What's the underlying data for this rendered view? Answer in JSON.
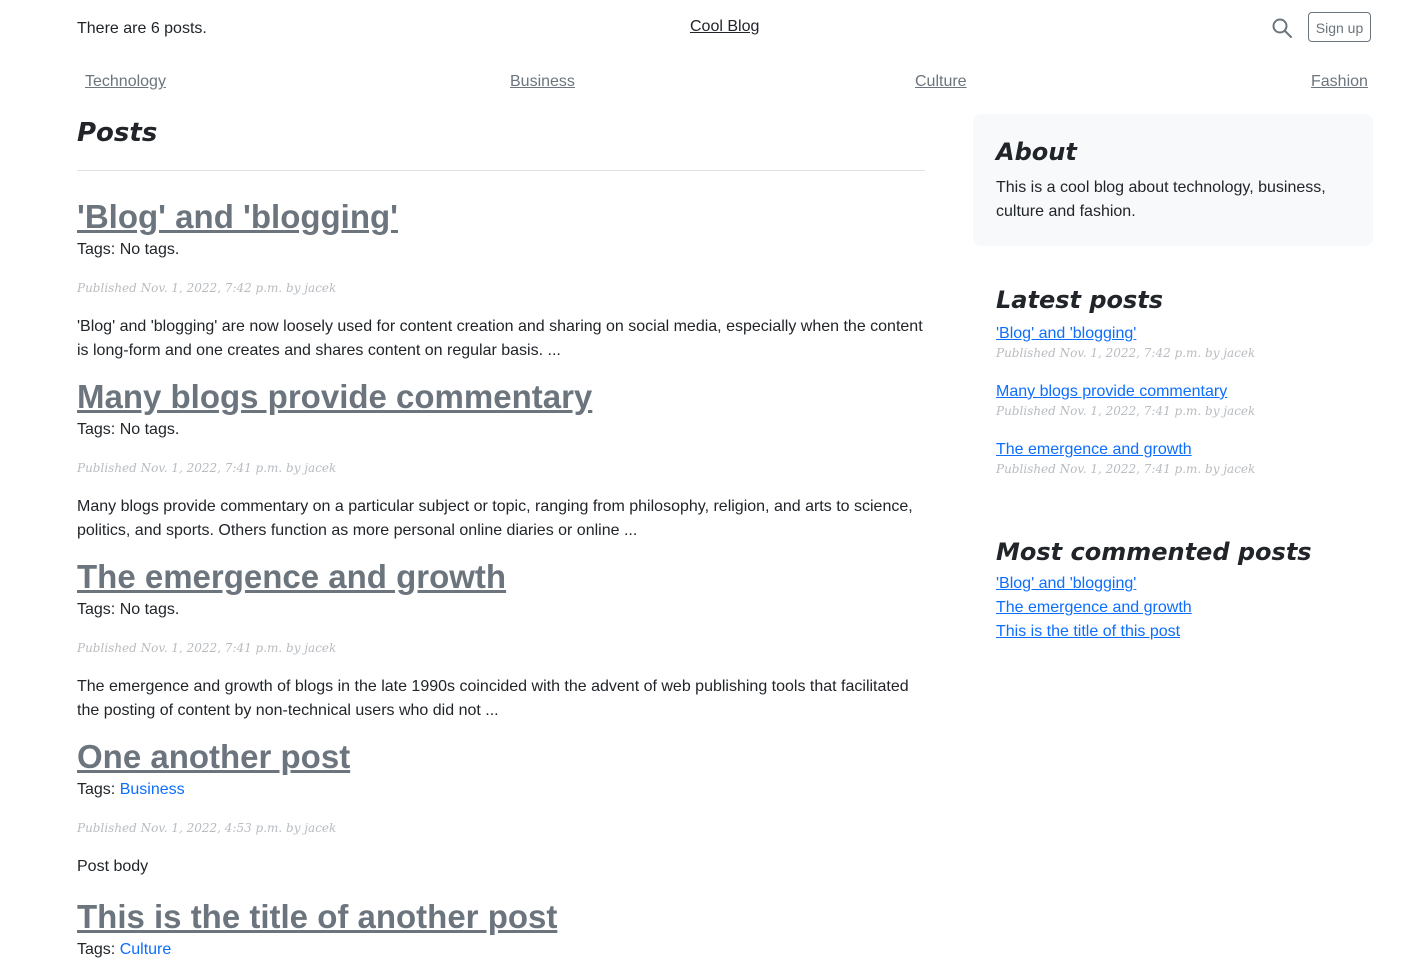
{
  "header": {
    "post_count_text": "There are 6 posts.",
    "brand": "Cool Blog",
    "signup_label": "Sign up"
  },
  "nav": {
    "items": [
      "Technology",
      "Business",
      "Culture",
      "Fashion"
    ]
  },
  "main": {
    "heading": "Posts",
    "posts": [
      {
        "title": "'Blog' and 'blogging'",
        "tags_label": "Tags:",
        "tags_value": "No tags.",
        "meta": "Published Nov. 1, 2022, 7:42 p.m. by jacek",
        "excerpt": "'Blog' and 'blogging' are now loosely used for content creation and sharing on social media, especially when the content is long-form and one creates and shares content on regular basis. ..."
      },
      {
        "title": "Many blogs provide commentary",
        "tags_label": "Tags:",
        "tags_value": "No tags.",
        "meta": "Published Nov. 1, 2022, 7:41 p.m. by jacek",
        "excerpt": "Many blogs provide commentary on a particular subject or topic, ranging from philosophy, religion, and arts to science, politics, and sports. Others function as more personal online diaries or online ..."
      },
      {
        "title": "The emergence and growth",
        "tags_label": "Tags:",
        "tags_value": "No tags.",
        "meta": "Published Nov. 1, 2022, 7:41 p.m. by jacek",
        "excerpt": "The emergence and growth of blogs in the late 1990s coincided with the advent of web publishing tools that facilitated the posting of content by non-technical users who did not ..."
      },
      {
        "title": "One another post",
        "tags_label": "Tags:",
        "tag_link": "Business",
        "meta": "Published Nov. 1, 2022, 4:53 p.m. by jacek",
        "excerpt": "Post body"
      },
      {
        "title": "This is the title of another post",
        "tags_label": "Tags:",
        "tag_link": "Culture"
      }
    ]
  },
  "sidebar": {
    "about": {
      "heading": "About",
      "text": "This is a cool blog about technology, business, culture and fashion."
    },
    "latest": {
      "heading": "Latest posts",
      "items": [
        {
          "title": "'Blog' and 'blogging'",
          "meta": "Published Nov. 1, 2022, 7:42 p.m. by jacek"
        },
        {
          "title": "Many blogs provide commentary",
          "meta": "Published Nov. 1, 2022, 7:41 p.m. by jacek"
        },
        {
          "title": "The emergence and growth",
          "meta": "Published Nov. 1, 2022, 7:41 p.m. by jacek"
        }
      ]
    },
    "most_commented": {
      "heading": "Most commented posts",
      "items": [
        "'Blog' and 'blogging'",
        "The emergence and growth",
        "This is the title of this post"
      ]
    }
  },
  "icons": {
    "search": "search-icon"
  },
  "colors": {
    "link": "#0d6efd",
    "muted": "#6c757d",
    "panel": "#f8f9fa"
  }
}
